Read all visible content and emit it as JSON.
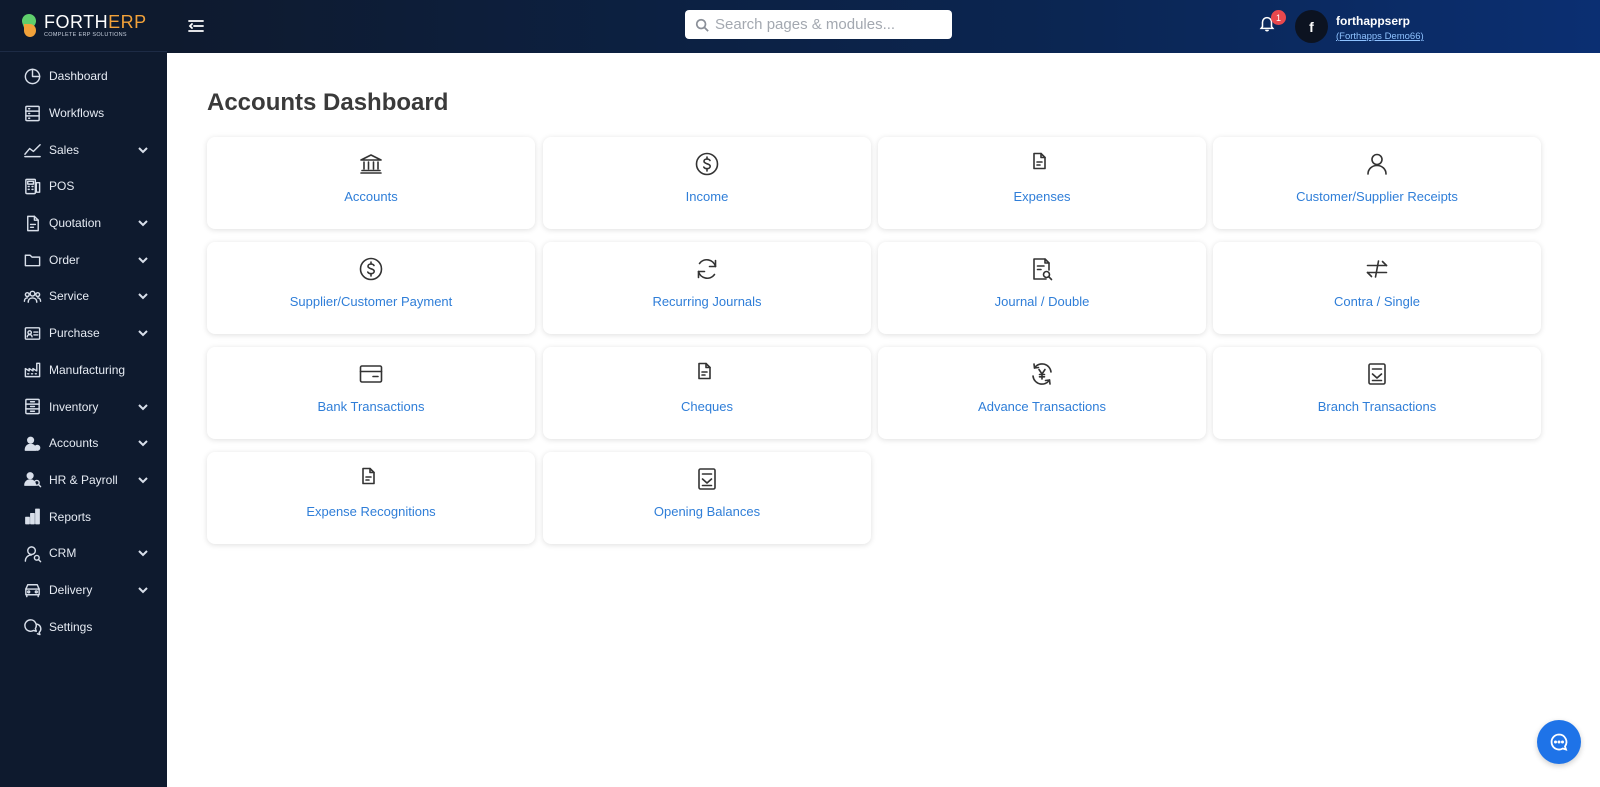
{
  "brand": {
    "name_part1": "FORTH",
    "name_part2": "ERP",
    "tagline": "COMPLETE ERP SOLUTIONS"
  },
  "search": {
    "placeholder": "Search pages & modules..."
  },
  "notifications": {
    "count": "1"
  },
  "user": {
    "initial": "f",
    "name": "forthappserp",
    "org": "(Forthapps Demo66)"
  },
  "sidebar": {
    "items": [
      {
        "label": "Dashboard",
        "icon": "pie-chart-icon",
        "expandable": false
      },
      {
        "label": "Workflows",
        "icon": "workflow-icon",
        "expandable": false
      },
      {
        "label": "Sales",
        "icon": "trend-line-icon",
        "expandable": true
      },
      {
        "label": "POS",
        "icon": "pos-terminal-icon",
        "expandable": false
      },
      {
        "label": "Quotation",
        "icon": "document-icon",
        "expandable": true
      },
      {
        "label": "Order",
        "icon": "folder-icon",
        "expandable": true
      },
      {
        "label": "Service",
        "icon": "people-icon",
        "expandable": true
      },
      {
        "label": "Purchase",
        "icon": "id-card-icon",
        "expandable": true
      },
      {
        "label": "Manufacturing",
        "icon": "factory-icon",
        "expandable": false
      },
      {
        "label": "Inventory",
        "icon": "inventory-icon",
        "expandable": true
      },
      {
        "label": "Accounts",
        "icon": "accounts-icon",
        "expandable": true
      },
      {
        "label": "HR & Payroll",
        "icon": "hr-icon",
        "expandable": true
      },
      {
        "label": "Reports",
        "icon": "bar-chart-icon",
        "expandable": false
      },
      {
        "label": "CRM",
        "icon": "crm-user-icon",
        "expandable": true
      },
      {
        "label": "Delivery",
        "icon": "truck-icon",
        "expandable": true
      },
      {
        "label": "Settings",
        "icon": "chat-bubbles-icon",
        "expandable": false
      }
    ]
  },
  "main": {
    "title": "Accounts Dashboard",
    "cards": [
      {
        "label": "Accounts",
        "icon": "bank-icon"
      },
      {
        "label": "Income",
        "icon": "dollar-circle-icon"
      },
      {
        "label": "Expenses",
        "icon": "document-icon"
      },
      {
        "label": "Customer/Supplier Receipts",
        "icon": "person-icon"
      },
      {
        "label": "Supplier/Customer Payment",
        "icon": "dollar-circle-icon"
      },
      {
        "label": "Recurring Journals",
        "icon": "refresh-icon"
      },
      {
        "label": "Journal / Double",
        "icon": "document-search-icon"
      },
      {
        "label": "Contra / Single",
        "icon": "swap-arrows-icon"
      },
      {
        "label": "Bank Transactions",
        "icon": "credit-card-icon"
      },
      {
        "label": "Cheques",
        "icon": "document-icon"
      },
      {
        "label": "Advance Transactions",
        "icon": "yen-cycle-icon"
      },
      {
        "label": "Branch Transactions",
        "icon": "receipt-icon"
      },
      {
        "label": "Expense Recognitions",
        "icon": "document-icon"
      },
      {
        "label": "Opening Balances",
        "icon": "receipt-icon"
      }
    ]
  },
  "chat": {
    "icon": "chat-icon"
  }
}
